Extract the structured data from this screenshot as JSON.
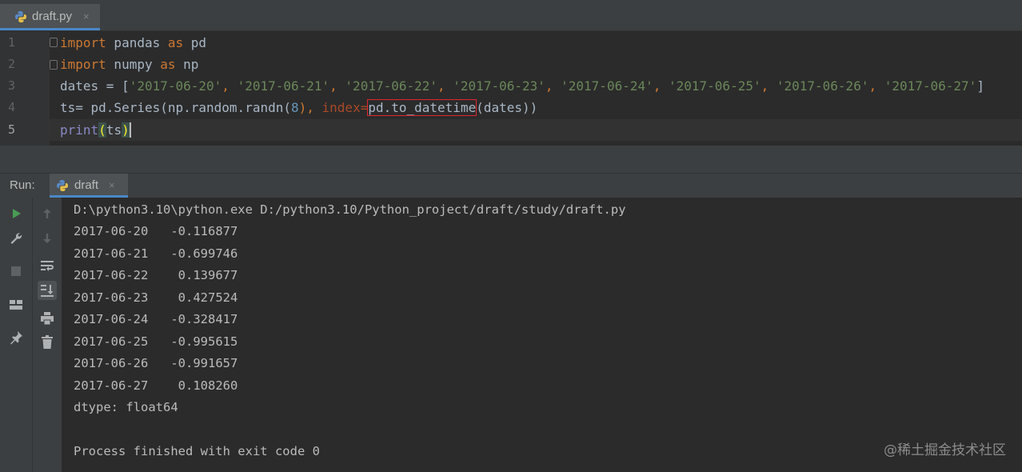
{
  "editor_tab": {
    "filename": "draft.py",
    "close": "×",
    "icon": "python-file-icon"
  },
  "gutter": {
    "line_numbers": [
      "1",
      "2",
      "3",
      "4",
      "5"
    ]
  },
  "code": {
    "line1": {
      "kw1": "import",
      "t1": " pandas ",
      "kw2": "as",
      "t2": " pd"
    },
    "line2": {
      "kw1": "import",
      "t1": " numpy ",
      "kw2": "as",
      "t2": " np"
    },
    "line3": {
      "prefix": "dates = [",
      "dates": [
        "'2017-06-20'",
        "'2017-06-21'",
        "'2017-06-22'",
        "'2017-06-23'",
        "'2017-06-24'",
        "'2017-06-25'",
        "'2017-06-26'",
        "'2017-06-27'"
      ],
      "sep": ", ",
      "suffix": "]"
    },
    "line4": {
      "t1": "ts= pd.Series(np.random.randn(",
      "n": "8",
      "t2": "), ",
      "param": "index",
      "eq": "=",
      "boxed": "pd.to_datetime",
      "t3": "(dates))"
    },
    "line5": {
      "fn": "print",
      "open": "(",
      "arg": "ts",
      "close": ")"
    }
  },
  "run_panel": {
    "label": "Run:",
    "tab": {
      "name": "draft",
      "close": "×",
      "icon": "python-run-icon"
    },
    "toolbar_icons": [
      "run-icon",
      "wrench-icon",
      "stop-icon",
      "layout-icon",
      "pin-icon",
      "up-arrow-icon",
      "down-arrow-icon",
      "soft-wrap-icon",
      "scroll-to-end-icon",
      "print-icon",
      "trash-icon"
    ]
  },
  "console": {
    "command": "D:\\python3.10\\python.exe D:/python3.10/Python_project/draft/study/draft.py",
    "rows": [
      {
        "date": "2017-06-20",
        "value": "-0.116877"
      },
      {
        "date": "2017-06-21",
        "value": "-0.699746"
      },
      {
        "date": "2017-06-22",
        "value": " 0.139677"
      },
      {
        "date": "2017-06-23",
        "value": " 0.427524"
      },
      {
        "date": "2017-06-24",
        "value": "-0.328417"
      },
      {
        "date": "2017-06-25",
        "value": "-0.995615"
      },
      {
        "date": "2017-06-26",
        "value": "-0.991657"
      },
      {
        "date": "2017-06-27",
        "value": " 0.108260"
      }
    ],
    "dtype": "dtype: float64",
    "finished": "Process finished with exit code 0"
  },
  "watermark": "@稀土掘金技术社区",
  "colors": {
    "keyword": "#cc7832",
    "string": "#6a8759",
    "number": "#6897bb",
    "param": "#aa4926",
    "accent": "#4a88c7",
    "box": "#e0262f"
  }
}
